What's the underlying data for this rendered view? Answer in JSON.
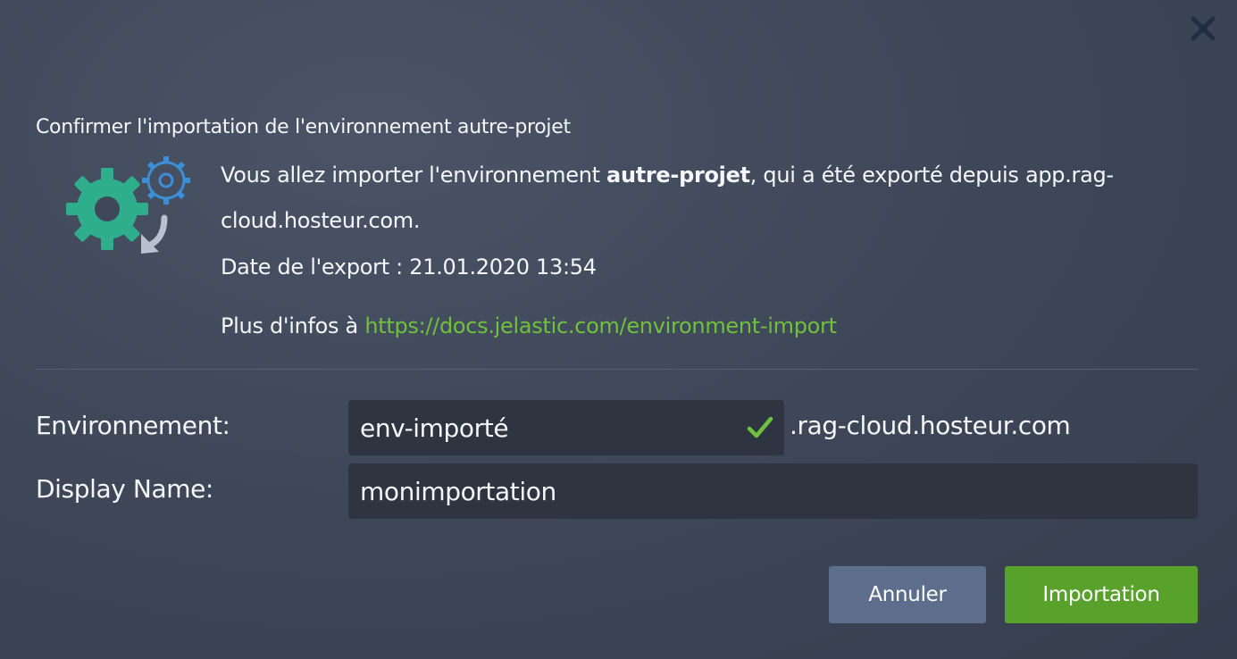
{
  "dialog": {
    "title": "Confirmer l'importation de l'environnement autre-projet",
    "message_before": "Vous allez importer l'environnement ",
    "message_env": "autre-projet",
    "message_after": ", qui a été exporté depuis app.rag-cloud.hosteur.com.",
    "export_date": "Date de l'export : 21.01.2020 13:54",
    "more_info_prefix": "Plus d'infos à ",
    "more_info_link": "https://docs.jelastic.com/environment-import",
    "icons": {
      "close": "close-icon",
      "import": "import-gears-icon",
      "valid": "checkmark-icon"
    }
  },
  "form": {
    "environment_label": "Environnement:",
    "environment_value": "env-importé",
    "environment_suffix": ".rag-cloud.hosteur.com",
    "display_name_label": "Display Name:",
    "display_name_value": "monimportation"
  },
  "buttons": {
    "cancel": "Annuler",
    "import": "Importation"
  },
  "colors": {
    "background": "#3f4859",
    "link": "#6fc13d",
    "input_bg": "#2e3440",
    "cancel_button": "#5d6d8c",
    "import_button": "#58a12b",
    "close_icon": "#1f2d45",
    "gear_primary": "#2fae8c",
    "gear_secondary": "#3b8fd6"
  }
}
